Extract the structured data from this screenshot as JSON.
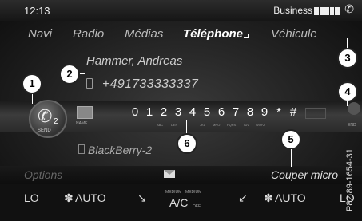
{
  "status": {
    "time": "12:13",
    "carrier": "Business",
    "signal_bars": 5
  },
  "nav": {
    "tabs": [
      {
        "label": "Navi"
      },
      {
        "label": "Radio"
      },
      {
        "label": "Médias"
      },
      {
        "label": "Téléphone"
      },
      {
        "label": "Véhicule"
      }
    ],
    "active_tab": "Téléphone"
  },
  "contact": {
    "name": "Hammer, Andreas",
    "number": "+491733333337"
  },
  "send": {
    "label": "SEND",
    "count": "2"
  },
  "keypad": {
    "name_label": "NAME",
    "keys": [
      "0",
      "1",
      "2",
      "3",
      "4",
      "5",
      "6",
      "7",
      "8",
      "9",
      "*",
      "#"
    ],
    "sub_labels": [
      "ABC",
      "DEF",
      "JKL",
      "MNO",
      "PQRS",
      "TUV",
      "WXYZ"
    ],
    "end_label": "END"
  },
  "device": {
    "name": "BlackBerry-2"
  },
  "functions": {
    "options": "Options",
    "mute": "Couper micro"
  },
  "climate": {
    "left_temp": "LO",
    "left_fan": "AUTO",
    "medium_left": "MEDIUM",
    "medium_right": "MEDIUM",
    "ac": "A/C",
    "ac_sub": "OFF",
    "right_fan": "AUTO",
    "right_temp": "LO"
  },
  "callouts": [
    "1",
    "2",
    "3",
    "4",
    "5",
    "6"
  ],
  "watermark": "P82.89-1654-31"
}
